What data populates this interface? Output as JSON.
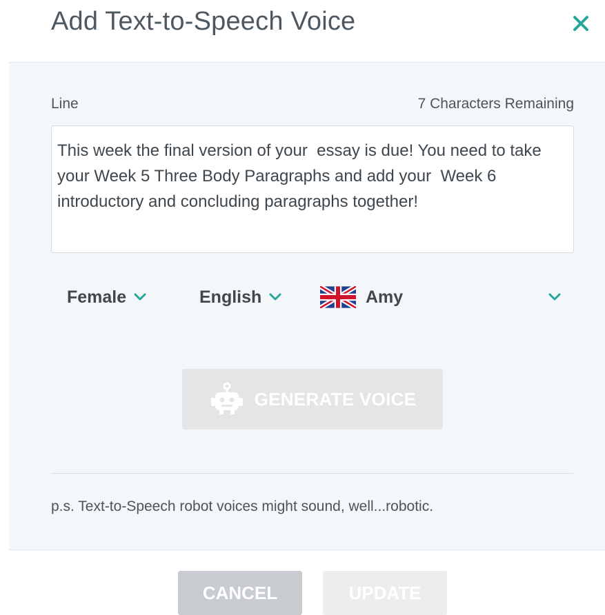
{
  "dialog": {
    "title": "Add Text-to-Speech Voice",
    "close_icon": "close-icon",
    "accent_color": "#26a69a"
  },
  "line": {
    "label": "Line",
    "remaining": "7 Characters Remaining",
    "value": "This week the final version of your  essay is due! You need to take your Week 5 Three Body Paragraphs and add your  Week 6 introductory and concluding paragraphs together!"
  },
  "selects": {
    "gender": "Female",
    "language": "English",
    "voice": "Amy",
    "voice_flag_icon": "uk-flag-icon",
    "chevron_icon": "chevron-down-icon"
  },
  "generate": {
    "label": "GENERATE VOICE",
    "icon": "robot-icon",
    "enabled": false
  },
  "note": "p.s. Text-to-Speech robot voices might sound, well...robotic.",
  "footer": {
    "cancel_label": "CANCEL",
    "update_label": "UPDATE",
    "update_enabled": false
  }
}
